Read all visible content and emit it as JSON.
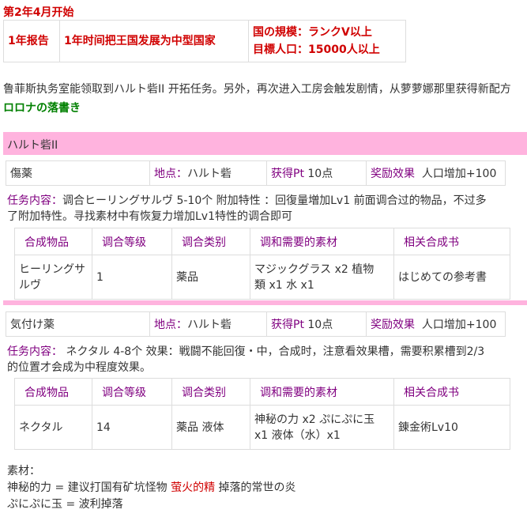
{
  "heading": "第2年4月开始",
  "report": {
    "label": "1年报告",
    "goal": "1年时间把王国发展为中型国家",
    "line1": "国の規模：ランクV以上",
    "line2": "目標人口：15000人以上"
  },
  "intro": {
    "line1": "鲁菲斯执务室能领取到ハルト砦II 开拓任务。另外，再次进入工房会触发剧情，从萝萝娜那里获得新配方",
    "line2": "ロロナの落書き"
  },
  "section": {
    "title": "ハルト砦II"
  },
  "labels": {
    "location": "地点：",
    "pt": "获得Pt",
    "reward": "奖励效果",
    "task": "任务内容："
  },
  "tasks": [
    {
      "name": "傷薬",
      "location": "ハルト砦",
      "pt": "10点",
      "reward": "人口增加+100",
      "content_line1": "调合ヒーリングサルヴ 5-10个  附加特性 ：回復量増加Lv1  前面调合过的物品，不过多",
      "content_line2": "了附加特性。寻找素材中有恢复力增加Lv1特性的调合即可",
      "table": {
        "headers": [
          "合成物品",
          "调合等级",
          "调合类别",
          "调和需要的素材",
          "相关合成书"
        ],
        "row": {
          "item_line1": "ヒーリングサ",
          "item_line2": "ルヴ",
          "level": "1",
          "category": "薬品",
          "materials_line1": "マジックグラス x2 植物",
          "materials_line2": "類 x1 水 x1",
          "book": "はじめての参考書"
        }
      }
    },
    {
      "name": "気付け薬",
      "location": "ハルト砦",
      "pt": "10点",
      "reward": "人口增加+100",
      "content_line1": " ネクタル 4-8个  效果：戦闘不能回復・中，合成时，注意看效果槽，需要积累槽到2/3",
      "content_line2": "的位置才会成为中程度效果。",
      "table": {
        "headers": [
          "合成物品",
          "调合等级",
          "调合类别",
          "调和需要的素材",
          "相关合成书"
        ],
        "row": {
          "item_line1": "ネクタル",
          "item_line2": "",
          "level": "14",
          "category": "薬品 液体",
          "materials_line1": "神秘の力 x2 ぷにぷに玉",
          "materials_line2": "x1 液体（水）x1",
          "book": "錬金術Lv10"
        }
      }
    }
  ],
  "footer": {
    "title": "素材：",
    "line1_a": "神秘的力 = 建议打国有矿坑怪物 ",
    "line1_highlight": "萤火的精",
    "line1_b": " 掉落的常世の炎",
    "line2": "ぷにぷに玉 = 波利掉落"
  },
  "colors": {
    "accent_red": "#d00000",
    "label_purple": "#800080",
    "link_green": "#008000",
    "section_pink": "#ffb3de"
  }
}
